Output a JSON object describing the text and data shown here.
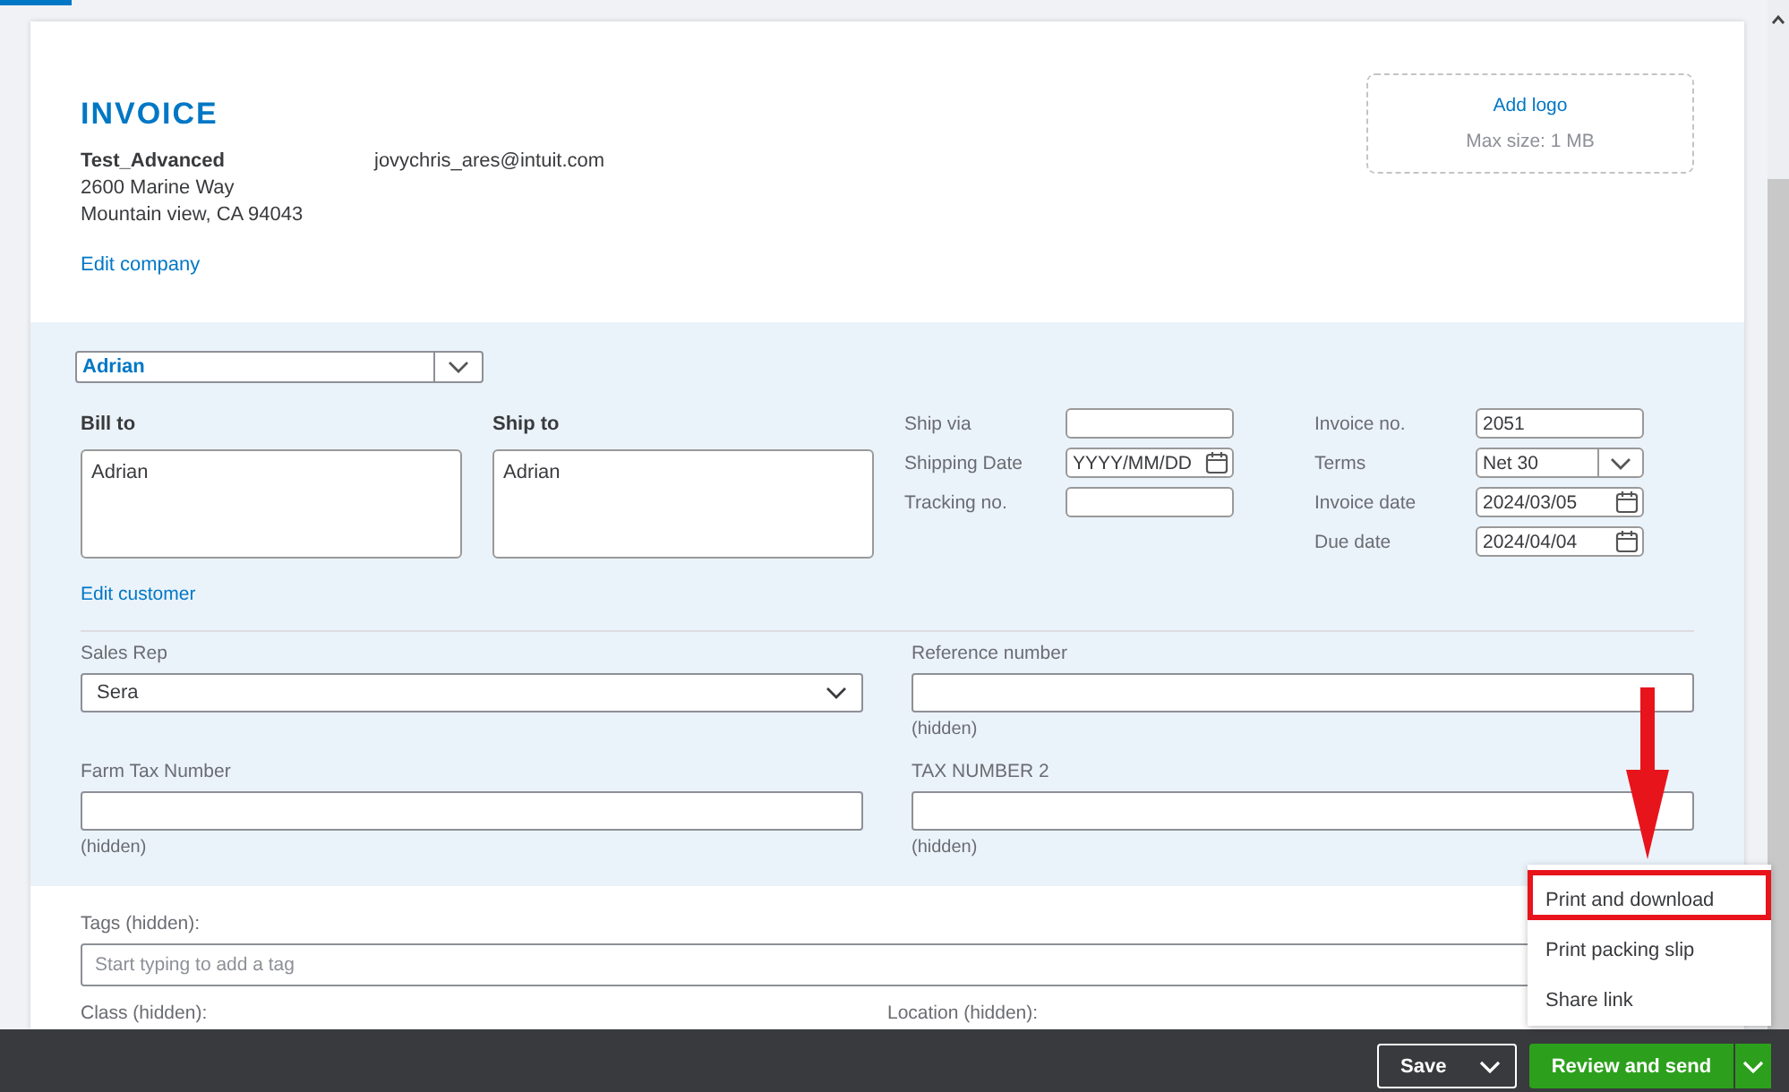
{
  "header": {
    "title": "INVOICE",
    "company_name": "Test_Advanced",
    "address_lines": [
      "2600 Marine Way",
      "Mountain view, CA 94043"
    ],
    "email": "jovychris_ares@intuit.com",
    "edit_company_link": "Edit company",
    "logo": {
      "action": "Add logo",
      "hint": "Max size: 1 MB"
    }
  },
  "customer": {
    "value": "Adrian",
    "bill_to": {
      "label": "Bill to",
      "value": "Adrian"
    },
    "ship_to": {
      "label": "Ship to",
      "value": "Adrian"
    },
    "edit_link": "Edit customer"
  },
  "shipping_fields": [
    {
      "label": "Ship via",
      "kind": "text"
    },
    {
      "label": "Shipping Date",
      "kind": "date",
      "placeholder": "YYYY/MM/DD"
    },
    {
      "label": "Tracking no.",
      "kind": "text"
    }
  ],
  "invoice_fields": [
    {
      "label": "Invoice no.",
      "kind": "text",
      "value": "2051"
    },
    {
      "label": "Terms",
      "kind": "select",
      "value": "Net 30"
    },
    {
      "label": "Invoice date",
      "kind": "date",
      "value": "2024/03/05"
    },
    {
      "label": "Due date",
      "kind": "date",
      "value": "2024/04/04"
    }
  ],
  "custom_fields": [
    {
      "label": "Sales Rep",
      "kind": "select",
      "value": "Sera"
    },
    {
      "label": "Reference number",
      "kind": "text",
      "note": "(hidden)"
    },
    {
      "label": "Farm Tax Number",
      "kind": "text",
      "note": "(hidden)"
    },
    {
      "label": "TAX NUMBER 2",
      "kind": "text",
      "note": "(hidden)"
    }
  ],
  "tags": {
    "label": "Tags (hidden):",
    "placeholder": "Start typing to add a tag"
  },
  "more_fields": [
    "Class (hidden):",
    "Location (hidden):"
  ],
  "footer": {
    "save": "Save",
    "primary": "Review and send"
  },
  "menu": {
    "items": [
      {
        "label": "Print and download",
        "highlighted": true
      },
      {
        "label": "Print packing slip",
        "highlighted": false
      },
      {
        "label": "Share link",
        "highlighted": false
      }
    ]
  },
  "annotation": {
    "arrow": true
  }
}
